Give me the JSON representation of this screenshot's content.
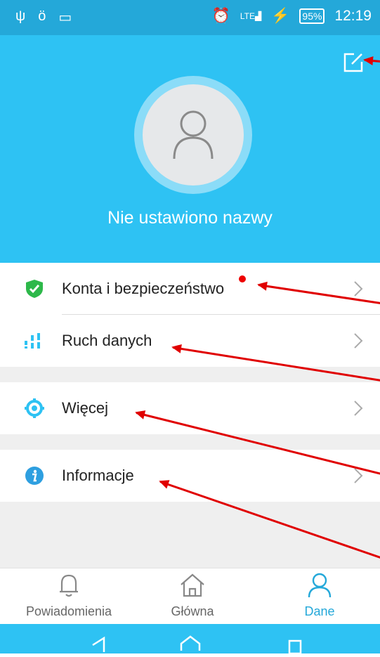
{
  "status": {
    "battery": "95%",
    "time": "12:19"
  },
  "profile": {
    "name": "Nie ustawiono nazwy"
  },
  "menu": [
    {
      "label": "Konta i bezpieczeństwo"
    },
    {
      "label": "Ruch danych"
    },
    {
      "label": "Więcej"
    },
    {
      "label": "Informacje"
    }
  ],
  "tabs": [
    {
      "label": "Powiadomienia"
    },
    {
      "label": "Główna"
    },
    {
      "label": "Dane"
    }
  ],
  "colors": {
    "accent": "#2ec2f3",
    "status_bar": "#24a8d9",
    "annotation": "#e00000",
    "shield": "#2db84a"
  }
}
